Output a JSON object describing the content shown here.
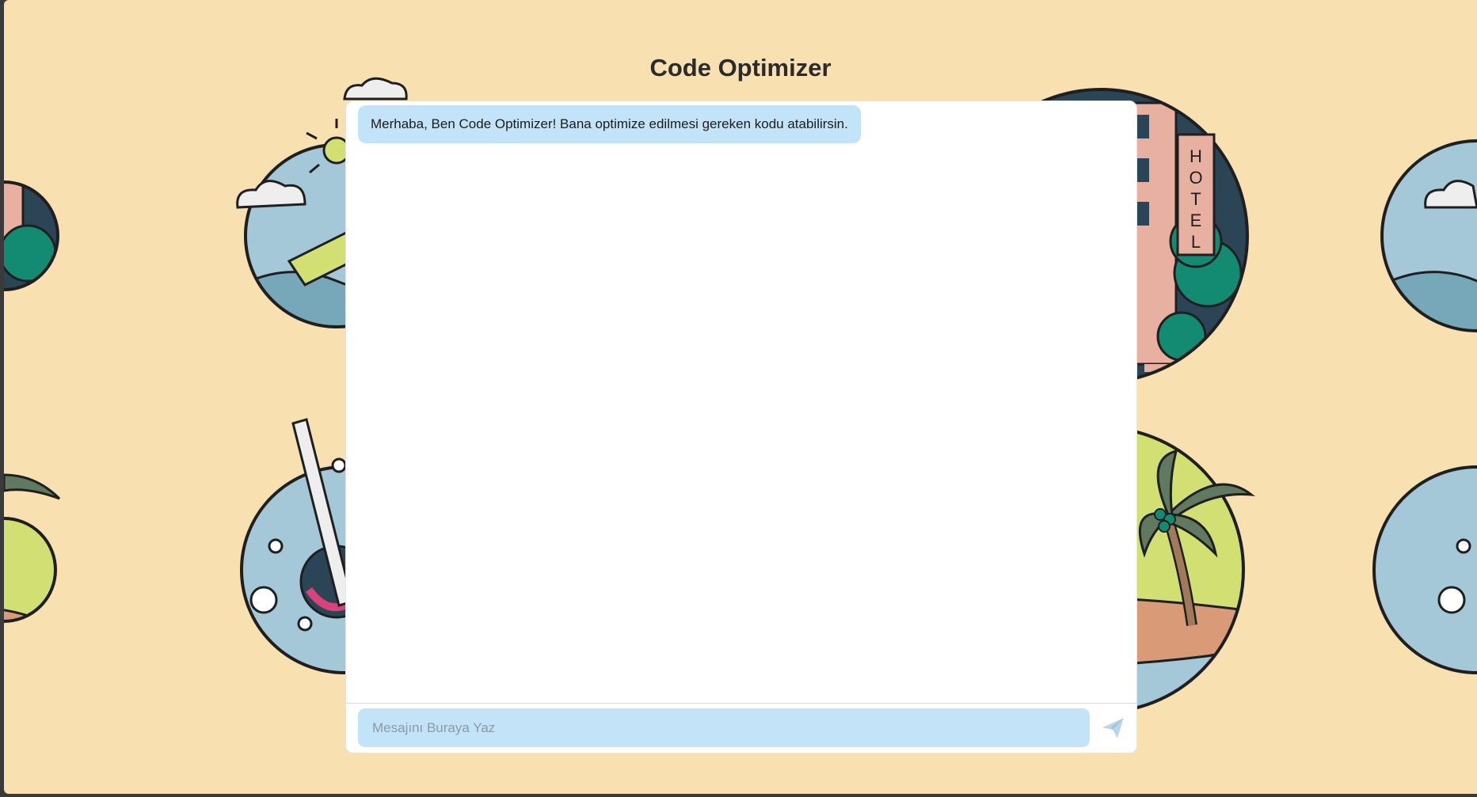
{
  "header": {
    "title": "Code Optimizer"
  },
  "chat": {
    "messages": [
      {
        "sender": "bot",
        "text": "Merhaba, Ben Code Optimizer! Bana optimize edilmesi gereken kodu atabilirsin."
      }
    ]
  },
  "composer": {
    "placeholder": "Mesajını Buraya Yaz",
    "value": "",
    "send_icon": "send-paper-plane-icon"
  },
  "background": {
    "theme": "travel-illustration-pattern",
    "tiles": [
      "hotel",
      "sun-clouds-boat",
      "palm-island",
      "ship-porthole-lifebuoy"
    ],
    "hotel_sign": "HOTEL"
  },
  "colors": {
    "page_background": "#f8e0b0",
    "bubble": "#c3e3f8",
    "input": "#c3e3f8",
    "send_icon": "#b9d6ea",
    "title": "#2b2b2b"
  }
}
